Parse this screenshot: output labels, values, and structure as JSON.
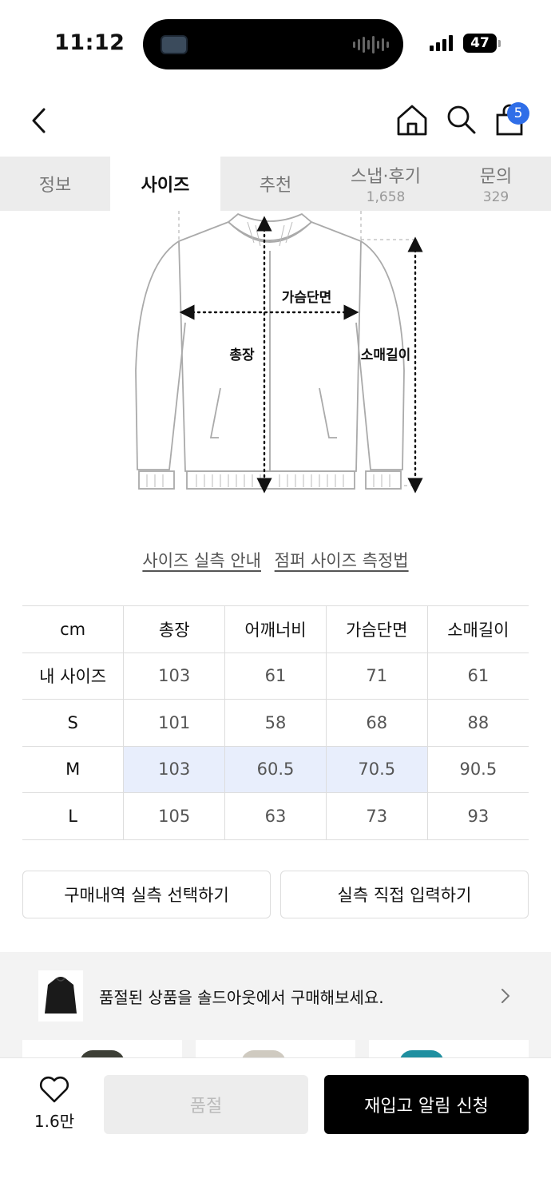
{
  "status_bar": {
    "time": "11:12",
    "battery": "47"
  },
  "header": {
    "cart_count": "5"
  },
  "tabs": [
    {
      "label": "정보",
      "sub": ""
    },
    {
      "label": "사이즈",
      "sub": ""
    },
    {
      "label": "추천",
      "sub": ""
    },
    {
      "label": "스냅·후기",
      "sub": "1,658"
    },
    {
      "label": "문의",
      "sub": "329"
    }
  ],
  "diagram": {
    "chest_label": "가슴단면",
    "length_label": "총장",
    "sleeve_label": "소매길이"
  },
  "guides": {
    "size_guide": "사이즈 실측 안내",
    "measure_guide": "점퍼 사이즈 측정법"
  },
  "size_table": {
    "headers": [
      "cm",
      "총장",
      "어깨너비",
      "가슴단면",
      "소매길이"
    ],
    "rows": [
      [
        "내 사이즈",
        "103",
        "61",
        "71",
        "61"
      ],
      [
        "S",
        "101",
        "58",
        "68",
        "88"
      ],
      [
        "M",
        "103",
        "60.5",
        "70.5",
        "90.5"
      ],
      [
        "L",
        "105",
        "63",
        "73",
        "93"
      ]
    ]
  },
  "actions": {
    "select_history": "구매내역 실측 선택하기",
    "direct_input": "실측 직접 입력하기"
  },
  "promo": {
    "text": "품절된 상품을 솔드아웃에서 구매해보세요."
  },
  "bottom": {
    "like_count": "1.6만",
    "soldout_label": "품절",
    "restock_label": "재입고 알림 신청"
  },
  "colors": {
    "accent": "#2f6ee8",
    "highlight": "#e8eefc"
  }
}
